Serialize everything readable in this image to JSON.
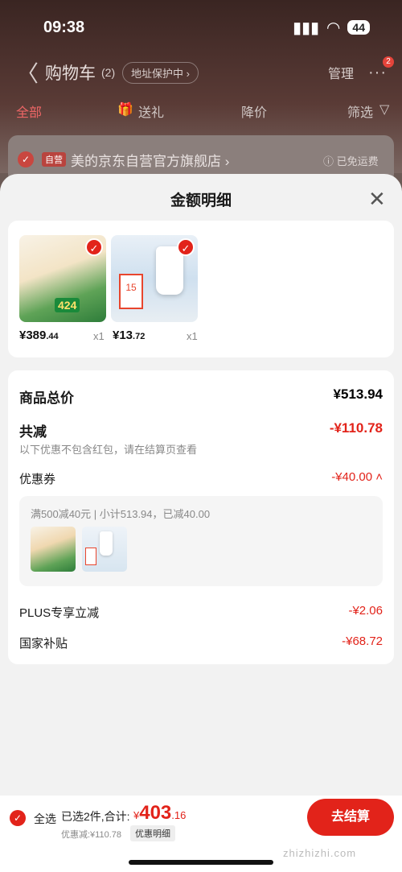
{
  "status": {
    "time": "09:38",
    "battery": "44"
  },
  "nav": {
    "back": "〈",
    "title": "购物车",
    "count": "(2)",
    "address": "地址保护中 ›",
    "manage": "管理",
    "more": "···",
    "badge": "2"
  },
  "tabs": {
    "all": "全部",
    "gift": "送礼",
    "price_drop": "降价",
    "filter": "筛选"
  },
  "store": {
    "tag": "自营",
    "name": "美的京东自营官方旗舰店 ›",
    "shipping": "ⓘ 已免运费"
  },
  "sheet": {
    "title": "金额明细",
    "close": "✕"
  },
  "products": [
    {
      "price_int": "¥389",
      "price_dec": ".44",
      "qty": "x1",
      "badge_text": "424"
    },
    {
      "price_int": "¥13",
      "price_dec": ".72",
      "qty": "x1",
      "badge_text": "15"
    }
  ],
  "summary": {
    "total_label": "商品总价",
    "total_value": "¥513.94",
    "reduce_label": "共减",
    "reduce_value": "-¥110.78",
    "reduce_note": "以下优惠不包含红包，请在结算页查看",
    "coupon_label": "优惠券",
    "coupon_value": "-¥40.00 ˄",
    "coupon_detail": "满500减40元 | 小计513.94，已减40.00",
    "plus_label": "PLUS专享立减",
    "plus_value": "-¥2.06",
    "subsidy_label": "国家补贴",
    "subsidy_value": "-¥68.72"
  },
  "bottom": {
    "select_all": "全选",
    "selected": "已选2件,合计:",
    "currency": "¥",
    "total_int": "403",
    "total_dec": ".16",
    "discount": "优惠减:¥110.78",
    "detail": "优惠明细",
    "checkout": "去结算",
    "watermark": "zhizhizhi.com"
  }
}
